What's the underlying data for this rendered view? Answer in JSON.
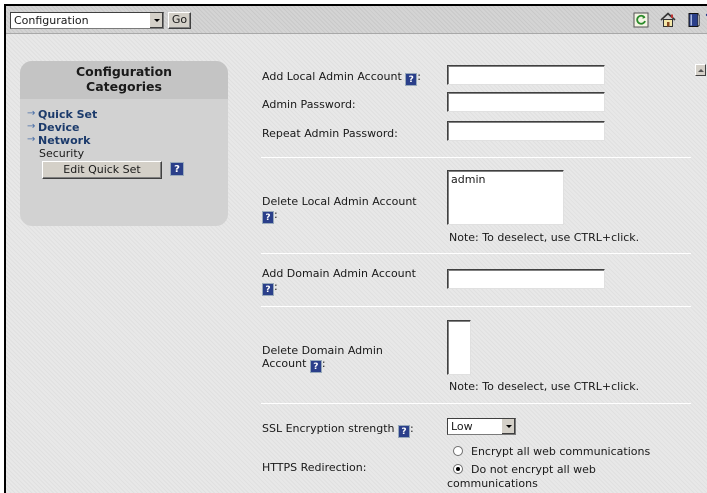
{
  "toolbar": {
    "category_select": "Configuration",
    "go_label": "Go",
    "help_label": "?"
  },
  "sidebar": {
    "title_line1": "Configuration",
    "title_line2": "Categories",
    "items": [
      {
        "label": "Quick Set"
      },
      {
        "label": "Device"
      },
      {
        "label": "Network"
      }
    ],
    "sub_label": "Security",
    "edit_button": "Edit Quick Set",
    "help": "?"
  },
  "form": {
    "help": "?",
    "add_local": {
      "label": "Add Local Admin Account",
      "suffix": ":"
    },
    "admin_password": {
      "label": "Admin Password:"
    },
    "repeat_password": {
      "label": "Repeat Admin Password:"
    },
    "delete_local": {
      "label": "Delete Local Admin Account",
      "suffix": ":",
      "options": [
        "admin"
      ],
      "note": "Note: To deselect, use CTRL+click."
    },
    "add_domain": {
      "label": "Add Domain Admin Account",
      "suffix": ":"
    },
    "delete_domain": {
      "label_line1": "Delete Domain Admin",
      "label_line2": "Account",
      "suffix": ":",
      "note": "Note: To deselect, use CTRL+click."
    },
    "ssl": {
      "label": "SSL Encryption strength",
      "suffix": ":",
      "value": "Low"
    },
    "https": {
      "label": "HTTPS Redirection:",
      "option1": "Encrypt all web communications",
      "option2_line1": "Do not encrypt all web",
      "option2_line2": "communications"
    }
  }
}
